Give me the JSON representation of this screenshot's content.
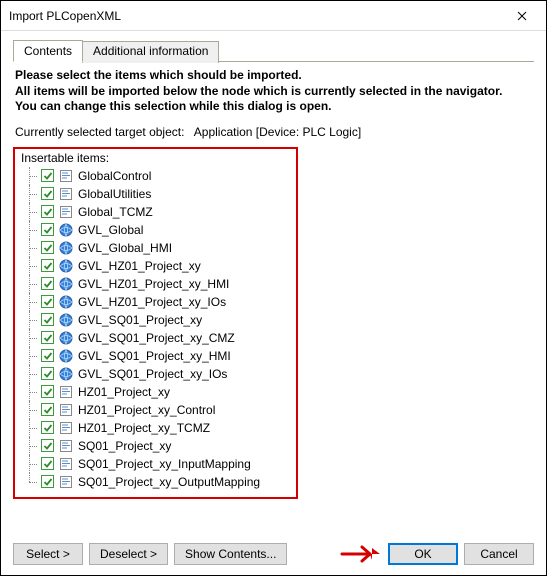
{
  "window": {
    "title": "Import PLCopenXML"
  },
  "tabs": {
    "contents": "Contents",
    "additional": "Additional information"
  },
  "instructions": {
    "line1": "Please select the items which should be imported.",
    "line2": "All items will be imported below the node which is currently selected in the navigator.",
    "line3": "You can change this selection while this dialog is open."
  },
  "target": {
    "label": "Currently selected target object:",
    "value": "Application [Device: PLC Logic]"
  },
  "items_label": "Insertable items:",
  "items": [
    {
      "label": "GlobalControl",
      "icon": "prg"
    },
    {
      "label": "GlobalUtilities",
      "icon": "prg"
    },
    {
      "label": "Global_TCMZ",
      "icon": "prg"
    },
    {
      "label": "GVL_Global",
      "icon": "gvl"
    },
    {
      "label": "GVL_Global_HMI",
      "icon": "gvl"
    },
    {
      "label": "GVL_HZ01_Project_xy",
      "icon": "gvl"
    },
    {
      "label": "GVL_HZ01_Project_xy_HMI",
      "icon": "gvl"
    },
    {
      "label": "GVL_HZ01_Project_xy_IOs",
      "icon": "gvl"
    },
    {
      "label": "GVL_SQ01_Project_xy",
      "icon": "gvl"
    },
    {
      "label": "GVL_SQ01_Project_xy_CMZ",
      "icon": "gvl"
    },
    {
      "label": "GVL_SQ01_Project_xy_HMI",
      "icon": "gvl"
    },
    {
      "label": "GVL_SQ01_Project_xy_IOs",
      "icon": "gvl"
    },
    {
      "label": "HZ01_Project_xy",
      "icon": "prg"
    },
    {
      "label": "HZ01_Project_xy_Control",
      "icon": "prg"
    },
    {
      "label": "HZ01_Project_xy_TCMZ",
      "icon": "prg"
    },
    {
      "label": "SQ01_Project_xy",
      "icon": "prg"
    },
    {
      "label": "SQ01_Project_xy_InputMapping",
      "icon": "prg"
    },
    {
      "label": "SQ01_Project_xy_OutputMapping",
      "icon": "prg"
    }
  ],
  "buttons": {
    "select": "Select >",
    "deselect": "Deselect >",
    "show_contents": "Show Contents...",
    "ok": "OK",
    "cancel": "Cancel"
  }
}
